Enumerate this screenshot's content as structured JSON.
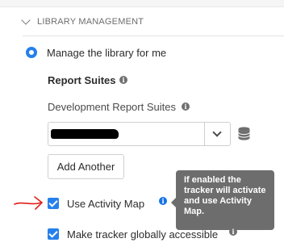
{
  "section": {
    "title": "LIBRARY MANAGEMENT",
    "chevron_icon": "chevron-down-icon"
  },
  "library": {
    "radio_label": "Manage the library for me",
    "radio_selected": true
  },
  "report_suites": {
    "heading": "Report Suites",
    "dev_label": "Development Report Suites",
    "add_another_label": "Add Another",
    "data_icon": "database-icon"
  },
  "activity_map": {
    "label": "Use Activity Map",
    "checked": true,
    "tooltip": "If enabled the tracker will activate and use Activity Map."
  },
  "global_tracker": {
    "label": "Make tracker globally accessible",
    "checked": true
  },
  "colors": {
    "accent": "#2680eb",
    "tooltip_bg": "#6d6d6d",
    "annotation_arrow": "#e0201b"
  }
}
